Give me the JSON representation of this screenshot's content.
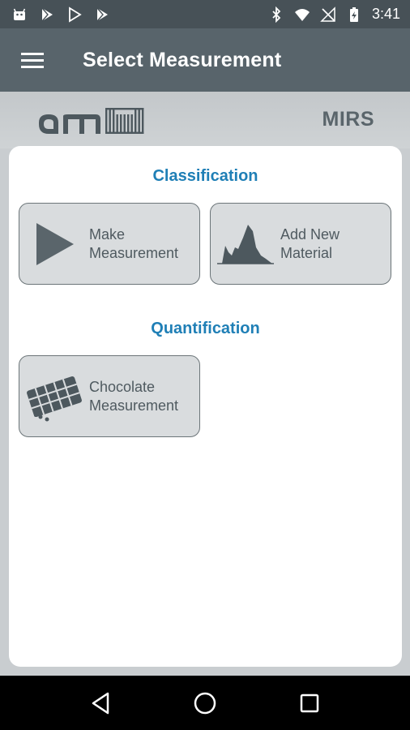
{
  "status_bar": {
    "time": "3:41",
    "left_icons": [
      "android-icon",
      "play-store-icon",
      "play-store-outline-icon",
      "play-store-icon"
    ],
    "right_icons": [
      "bluetooth-icon",
      "wifi-icon",
      "no-signal-icon",
      "battery-charging-icon"
    ]
  },
  "toolbar": {
    "title": "Select Measurement",
    "menu_icon": "hamburger-menu-icon"
  },
  "brand": {
    "logo": "ams logo",
    "product": "MIRS"
  },
  "sections": {
    "classification": {
      "title": "Classification",
      "tiles": [
        {
          "label": "Make\nMeasurement",
          "icon": "play-icon"
        },
        {
          "label": "Add New\nMaterial",
          "icon": "spectrum-icon"
        }
      ]
    },
    "quantification": {
      "title": "Quantification",
      "tiles": [
        {
          "label": "Chocolate\nMeasurement",
          "icon": "chocolate-bar-icon"
        }
      ]
    }
  },
  "nav_bar": {
    "back": "back-icon",
    "home": "home-icon",
    "recents": "recents-icon"
  },
  "colors": {
    "toolbar": "#58646b",
    "status_bar": "#475157",
    "section_title": "#1f7fb6",
    "tile_bg": "#d9dcde",
    "tile_text": "#4f5a60"
  }
}
